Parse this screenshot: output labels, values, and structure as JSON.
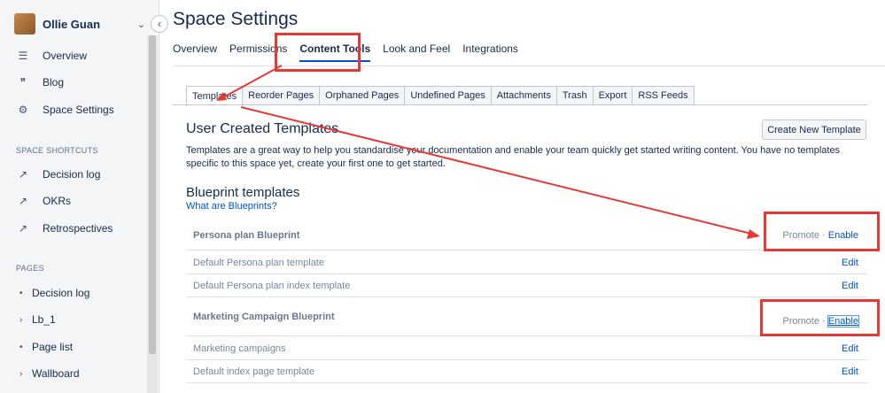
{
  "sidebar": {
    "user_name": "Ollie Guan",
    "collapse_icon": "chevron-left-icon",
    "nav": [
      {
        "label": "Overview",
        "icon": "lines-icon",
        "glyph": "☰"
      },
      {
        "label": "Blog",
        "icon": "quote-icon",
        "glyph": "❞"
      },
      {
        "label": "Space Settings",
        "icon": "gear-icon",
        "glyph": "⚙"
      }
    ],
    "shortcuts_title": "SPACE SHORTCUTS",
    "shortcuts": [
      {
        "label": "Decision log",
        "icon": "external-link-icon",
        "glyph": "↗"
      },
      {
        "label": "OKRs",
        "icon": "external-link-icon",
        "glyph": "↗"
      },
      {
        "label": "Retrospectives",
        "icon": "external-link-icon",
        "glyph": "↗"
      }
    ],
    "pages_title": "PAGES",
    "pages": [
      {
        "label": "Decision log",
        "marker": "•"
      },
      {
        "label": "Lb_1",
        "marker": "›"
      },
      {
        "label": "Page list",
        "marker": "•"
      },
      {
        "label": "Wallboard",
        "marker": "›"
      }
    ]
  },
  "page": {
    "title": "Space Settings",
    "tabs": [
      "Overview",
      "Permissions",
      "Content Tools",
      "Look and Feel",
      "Integrations"
    ],
    "active_tab": "Content Tools",
    "subtabs": [
      "Templates",
      "Reorder Pages",
      "Orphaned Pages",
      "Undefined Pages",
      "Attachments",
      "Trash",
      "Export",
      "RSS Feeds"
    ],
    "active_subtab": "Templates"
  },
  "user_templates": {
    "heading": "User Created Templates",
    "create_button": "Create New Template",
    "description": "Templates are a great way to help you standardise your documentation and enable your team quickly get started writing content. You have no templates specific to this space yet, create your first one to get started."
  },
  "blueprints": {
    "heading": "Blueprint templates",
    "link": "What are Blueprints?",
    "promote": "Promote",
    "separator": " · ",
    "enable": "Enable",
    "edit": "Edit",
    "groups": [
      {
        "name": "Persona plan Blueprint",
        "templates": [
          "Default Persona plan template",
          "Default Persona plan index template"
        ]
      },
      {
        "name": "Marketing Campaign Blueprint",
        "templates": [
          "Marketing campaigns",
          "Default index page template"
        ]
      }
    ]
  },
  "colors": {
    "accent": "#0052cc",
    "annotation": "#e53935",
    "sidebar_bg": "#f4f5f7"
  }
}
